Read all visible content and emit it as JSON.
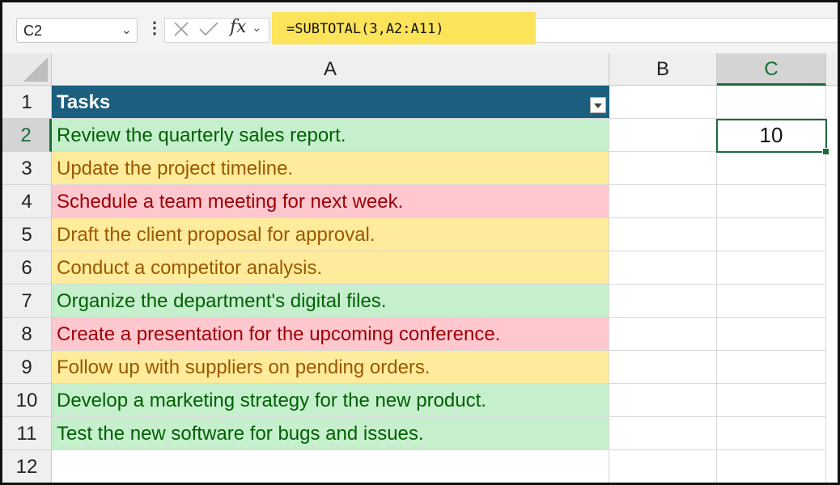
{
  "name_box": {
    "value": "C2"
  },
  "formula_bar": {
    "formula": "=SUBTOTAL(3,A2:A11)",
    "fx_label": "fx"
  },
  "columns": [
    "A",
    "B",
    "C"
  ],
  "active_column": "C",
  "rows": [
    "1",
    "2",
    "3",
    "4",
    "5",
    "6",
    "7",
    "8",
    "9",
    "10",
    "11",
    "12"
  ],
  "active_row": "2",
  "table": {
    "header": "Tasks",
    "tasks": [
      {
        "text": "Review the quarterly sales report.",
        "status": "green"
      },
      {
        "text": "Update the project timeline.",
        "status": "yellow"
      },
      {
        "text": "Schedule a team meeting for next week.",
        "status": "red"
      },
      {
        "text": "Draft the client proposal for approval.",
        "status": "yellow"
      },
      {
        "text": "Conduct a competitor analysis.",
        "status": "yellow"
      },
      {
        "text": "Organize the department's digital files.",
        "status": "green"
      },
      {
        "text": "Create a presentation for the upcoming conference.",
        "status": "red"
      },
      {
        "text": "Follow up with suppliers on pending orders.",
        "status": "yellow"
      },
      {
        "text": "Develop a marketing strategy for the new product.",
        "status": "green"
      },
      {
        "text": "Test the new software for bugs and issues.",
        "status": "green"
      }
    ]
  },
  "result_cell": {
    "value": "10"
  },
  "colors": {
    "green_fill": "#c6efce",
    "green_text": "#006100",
    "yellow_fill": "#ffeb9c",
    "yellow_text": "#9c5700",
    "red_fill": "#ffc7ce",
    "red_text": "#9c0006",
    "header_fill": "#1b5e7e",
    "formula_highlight": "#fbe35a",
    "selection": "#1a6b3c"
  }
}
